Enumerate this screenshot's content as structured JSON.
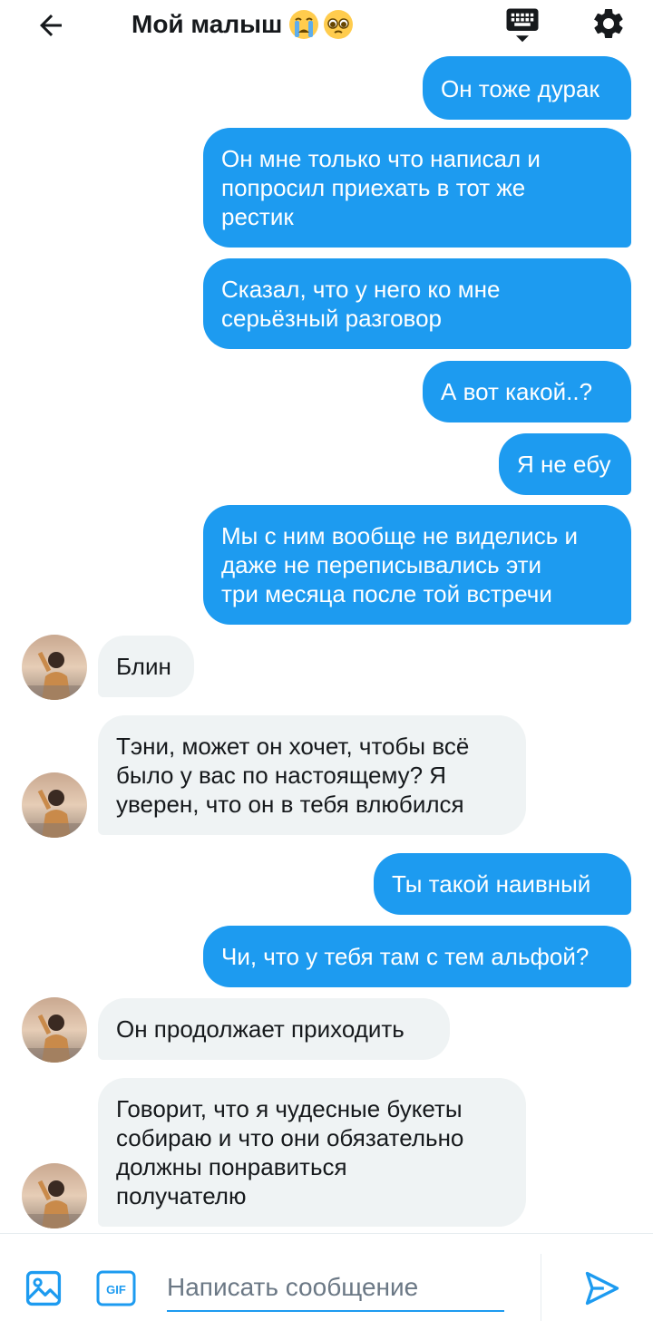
{
  "header": {
    "title": "Мой малыш",
    "emoji_1": "crying-face",
    "emoji_2": "pleading-face"
  },
  "colors": {
    "outgoing_bubble": "#1d9bf0",
    "incoming_bubble": "#eff3f4",
    "accent": "#1d9bf0"
  },
  "messages": [
    {
      "side": "out",
      "text": "Он тоже дурак"
    },
    {
      "side": "out",
      "text": "Он мне только что написал и\nпопросил приехать в тот же\nрестик"
    },
    {
      "side": "out",
      "text": "Сказал, что у него ко мне\nсерьёзный разговор"
    },
    {
      "side": "out",
      "text": "А вот какой..?"
    },
    {
      "side": "out",
      "text": "Я не ебу"
    },
    {
      "side": "out",
      "text": "Мы с ним вообще не виделись и\nдаже не переписывались эти\nтри месяца после той встречи"
    },
    {
      "side": "in",
      "text": "Блин"
    },
    {
      "side": "in",
      "text": "Тэни, может он хочет, чтобы всё\nбыло у вас по настоящему? Я\nуверен, что он в тебя влюбился"
    },
    {
      "side": "out",
      "text": "Ты такой наивный"
    },
    {
      "side": "out",
      "text": "Чи, что у тебя там с тем альфой?"
    },
    {
      "side": "in",
      "text": "Он продолжает приходить"
    },
    {
      "side": "in",
      "text": "Говорит, что я чудесные букеты\nсобираю и что они обязательно\nдолжны понравиться\nполучателю"
    }
  ],
  "composer": {
    "placeholder": "Написать сообщение",
    "value": "",
    "gif_label": "GIF"
  }
}
